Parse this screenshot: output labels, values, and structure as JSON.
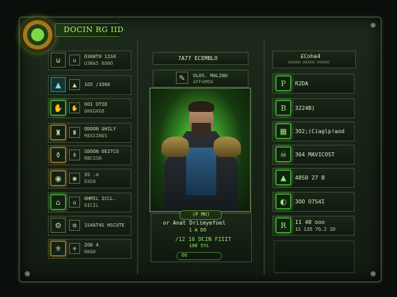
{
  "header": {
    "title": "DOCIN RG IID"
  },
  "left_slots": [
    {
      "icon": "rune-icon",
      "glyph": "⊍",
      "tone": "default",
      "line1": "O308T0 11S0",
      "line2": "U3NA5 6O0O"
    },
    {
      "icon": "helmet-icon",
      "glyph": "▲",
      "tone": "teal",
      "line1": "1O5 /1O66",
      "line2": ""
    },
    {
      "icon": "claw-icon",
      "glyph": "✋",
      "tone": "green",
      "line1": "OO1 OTID",
      "line2": "GKKGXGO"
    },
    {
      "icon": "figure-icon",
      "glyph": "♜",
      "tone": "gold",
      "line1": "ODOON GHILY",
      "line2": "REAIINGS"
    },
    {
      "icon": "flask-icon",
      "glyph": "⚱",
      "tone": "gold",
      "line1": "SDOON OEITCO",
      "line2": "RBCSSN"
    },
    {
      "icon": "eye-icon",
      "glyph": "◉",
      "tone": "gold",
      "line1": "3S .o",
      "line2": "O3S0"
    },
    {
      "icon": "boots-icon",
      "glyph": "⌂",
      "tone": "green",
      "line1": "OHMIL ICCL.",
      "line2": "OICIL"
    },
    {
      "icon": "gear-icon",
      "glyph": "⚙",
      "tone": "default",
      "line1": "1S4AT4S HSCUTE",
      "line2": ""
    },
    {
      "icon": "crest-icon",
      "glyph": "⚜",
      "tone": "gold",
      "line1": "2O6 4",
      "line2": "DKGO"
    }
  ],
  "center": {
    "tab1": "7A77 ECEMBLO",
    "tab2_line1": "OLOS. MALINU",
    "tab2_line2": "AFFAMOA",
    "tag": "(P MO)",
    "name": "or Anat Driimyefoel",
    "sub": "1 A DO",
    "stat": "/12 16 DCIN FIIIT",
    "stat2": "100 5YL",
    "pill": "OO"
  },
  "right": {
    "header": "£Coha4",
    "header_sub": "OOOOOO OOOOOO OOOOOO",
    "slots": [
      {
        "icon": "p-rune-icon",
        "glyph": "P",
        "line1": "R2DA",
        "line2": ""
      },
      {
        "icon": "b-rune-icon",
        "glyph": "B",
        "line1": "3224B)",
        "line2": ""
      },
      {
        "icon": "chest-icon",
        "glyph": "▦",
        "line1": "3O2;(Ciaglp!aod",
        "line2": ""
      },
      {
        "icon": "skull-icon",
        "glyph": "☠",
        "line1": "364 MAVICOST",
        "line2": ""
      },
      {
        "icon": "mountain-icon",
        "glyph": "▲",
        "line1": "48S0 27 B",
        "line2": ""
      },
      {
        "icon": "moon-icon",
        "glyph": "◐",
        "line1": "3OO O7S4I",
        "line2": ""
      },
      {
        "icon": "r-rune-icon",
        "glyph": "R",
        "line1": "11 40 ooo",
        "line2": "1S 135 7G.2 1O"
      }
    ]
  },
  "colors": {
    "accent": "#7fd64a",
    "gold": "#b58a2b"
  }
}
